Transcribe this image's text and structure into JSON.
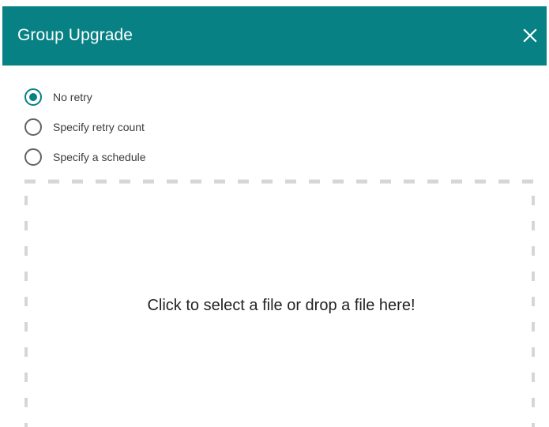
{
  "dialog": {
    "title": "Group Upgrade",
    "close_icon": "close-icon",
    "header_color": "#078184"
  },
  "retry_options": {
    "selected": "No retry",
    "items": [
      {
        "label": "No retry",
        "checked": true
      },
      {
        "label": "Specify retry count",
        "checked": false
      },
      {
        "label": "Specify a schedule",
        "checked": false
      }
    ]
  },
  "dropzone": {
    "text": "Click to select a file or drop a file here!"
  }
}
